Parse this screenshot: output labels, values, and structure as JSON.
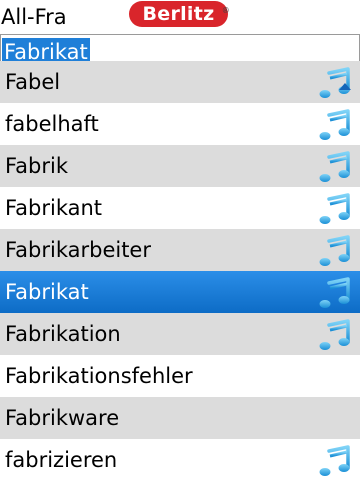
{
  "header": {
    "dict_label": "All-Fra",
    "logo_text": "Berlitz",
    "logo_reg": "®"
  },
  "search": {
    "value": "Fabrikat"
  },
  "list": {
    "rows": [
      {
        "word": "Fabel",
        "audio": true
      },
      {
        "word": "fabelhaft",
        "audio": true
      },
      {
        "word": "Fabrik",
        "audio": true
      },
      {
        "word": "Fabrikant",
        "audio": true
      },
      {
        "word": "Fabrikarbeiter",
        "audio": true
      },
      {
        "word": "Fabrikat",
        "audio": true
      },
      {
        "word": "Fabrikation",
        "audio": true
      },
      {
        "word": "Fabrikationsfehler",
        "audio": false
      },
      {
        "word": "Fabrikware",
        "audio": false
      },
      {
        "word": "fabrizieren",
        "audio": true
      }
    ],
    "selected_index": 5
  },
  "colors": {
    "selection": "#1f7fd8",
    "row_alt": "#dcdcdc",
    "note_icon": "#29a8e6",
    "logo": "#d9252b"
  },
  "icons": {
    "audio": "music-note-icon",
    "scroll": "scroll-up-arrow-icon"
  }
}
